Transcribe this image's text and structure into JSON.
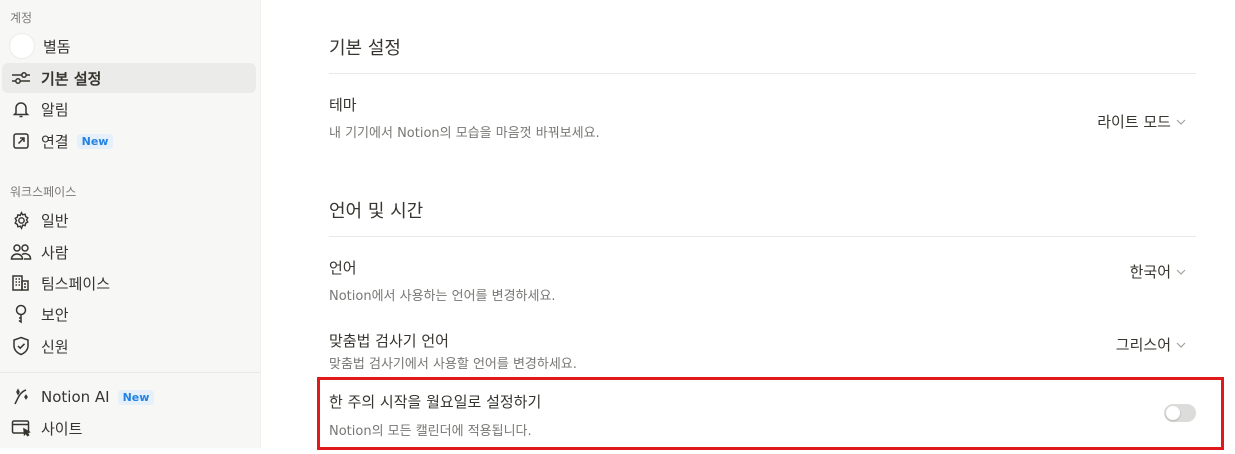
{
  "sidebar": {
    "account_section": "계정",
    "account_items": [
      {
        "label": "별돔",
        "icon": "avatar"
      },
      {
        "label": "기본 설정",
        "icon": "sliders-icon",
        "active": true
      },
      {
        "label": "알림",
        "icon": "bell-icon"
      },
      {
        "label": "연결",
        "icon": "external-link-icon",
        "badge": "New"
      }
    ],
    "workspace_section": "워크스페이스",
    "workspace_items": [
      {
        "label": "일반",
        "icon": "gear-icon"
      },
      {
        "label": "사람",
        "icon": "people-icon"
      },
      {
        "label": "팀스페이스",
        "icon": "building-icon"
      },
      {
        "label": "보안",
        "icon": "key-icon"
      },
      {
        "label": "신원",
        "icon": "shield-check-icon"
      }
    ],
    "extra_items": [
      {
        "label": "Notion AI",
        "icon": "ai-icon",
        "badge": "New"
      },
      {
        "label": "사이트",
        "icon": "site-icon"
      }
    ]
  },
  "main": {
    "preferences_title": "기본 설정",
    "theme": {
      "title": "테마",
      "description": "내 기기에서 Notion의 모습을 마음껏 바꿔보세요.",
      "value": "라이트 모드"
    },
    "language_time_title": "언어 및 시간",
    "language": {
      "title": "언어",
      "description": "Notion에서 사용하는 언어를 변경하세요.",
      "value": "한국어"
    },
    "spellcheck": {
      "title": "맞춤법 검사기 언어",
      "description": "맞춤법 검사기에서 사용할 언어를 변경하세요.",
      "value": "그리스어"
    },
    "week_start": {
      "title": "한 주의 시작을 월요일로 설정하기",
      "description": "Notion의 모든 캘린더에 적용됩니다.",
      "enabled": false
    }
  },
  "colors": {
    "highlight": "#e0191a",
    "badge_text": "#2383e2",
    "badge_bg": "#e6f0fb"
  }
}
